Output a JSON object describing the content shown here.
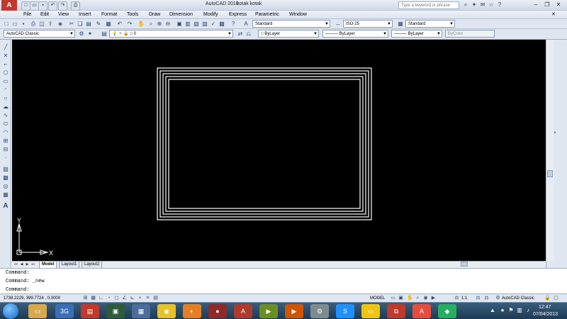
{
  "title": {
    "app": "AutoCAD 2010",
    "file": "kotak kotak",
    "search_placeholder": "Type a keyword or phrase"
  },
  "menu": [
    "File",
    "Edit",
    "View",
    "Insert",
    "Format",
    "Tools",
    "Draw",
    "Dimension",
    "Modify",
    "Express",
    "Parametric",
    "Window"
  ],
  "toolbar1": {
    "text_style": "Standard",
    "dim_style": "ISO-25",
    "table_style": "Standard"
  },
  "toolbar2": {
    "workspace": "AutoCAD Classic",
    "layer": "0",
    "color": "ByLayer",
    "linetype": "ByLayer",
    "lineweight": "ByLayer",
    "plotstyle": "ByColor"
  },
  "ucs": {
    "x": "X",
    "y": "Y"
  },
  "tabs": [
    "Model",
    "Layout1",
    "Layout2"
  ],
  "command": {
    "line1": "Command:",
    "line2": "Command: _new",
    "prompt": "Command:"
  },
  "status": {
    "coords": "1738.2229, 399.7724 , 0.0000",
    "model": "MODEL",
    "scale": "1:1",
    "workspace": "AutoCAD Classic"
  },
  "clock": {
    "time": "12:47",
    "date": "07/04/2013"
  },
  "colors": {
    "canvas": "#000000",
    "lines": "#ffffff",
    "taskbar": "#2a4a68"
  },
  "drawing": {
    "rectangle_count": 5
  }
}
